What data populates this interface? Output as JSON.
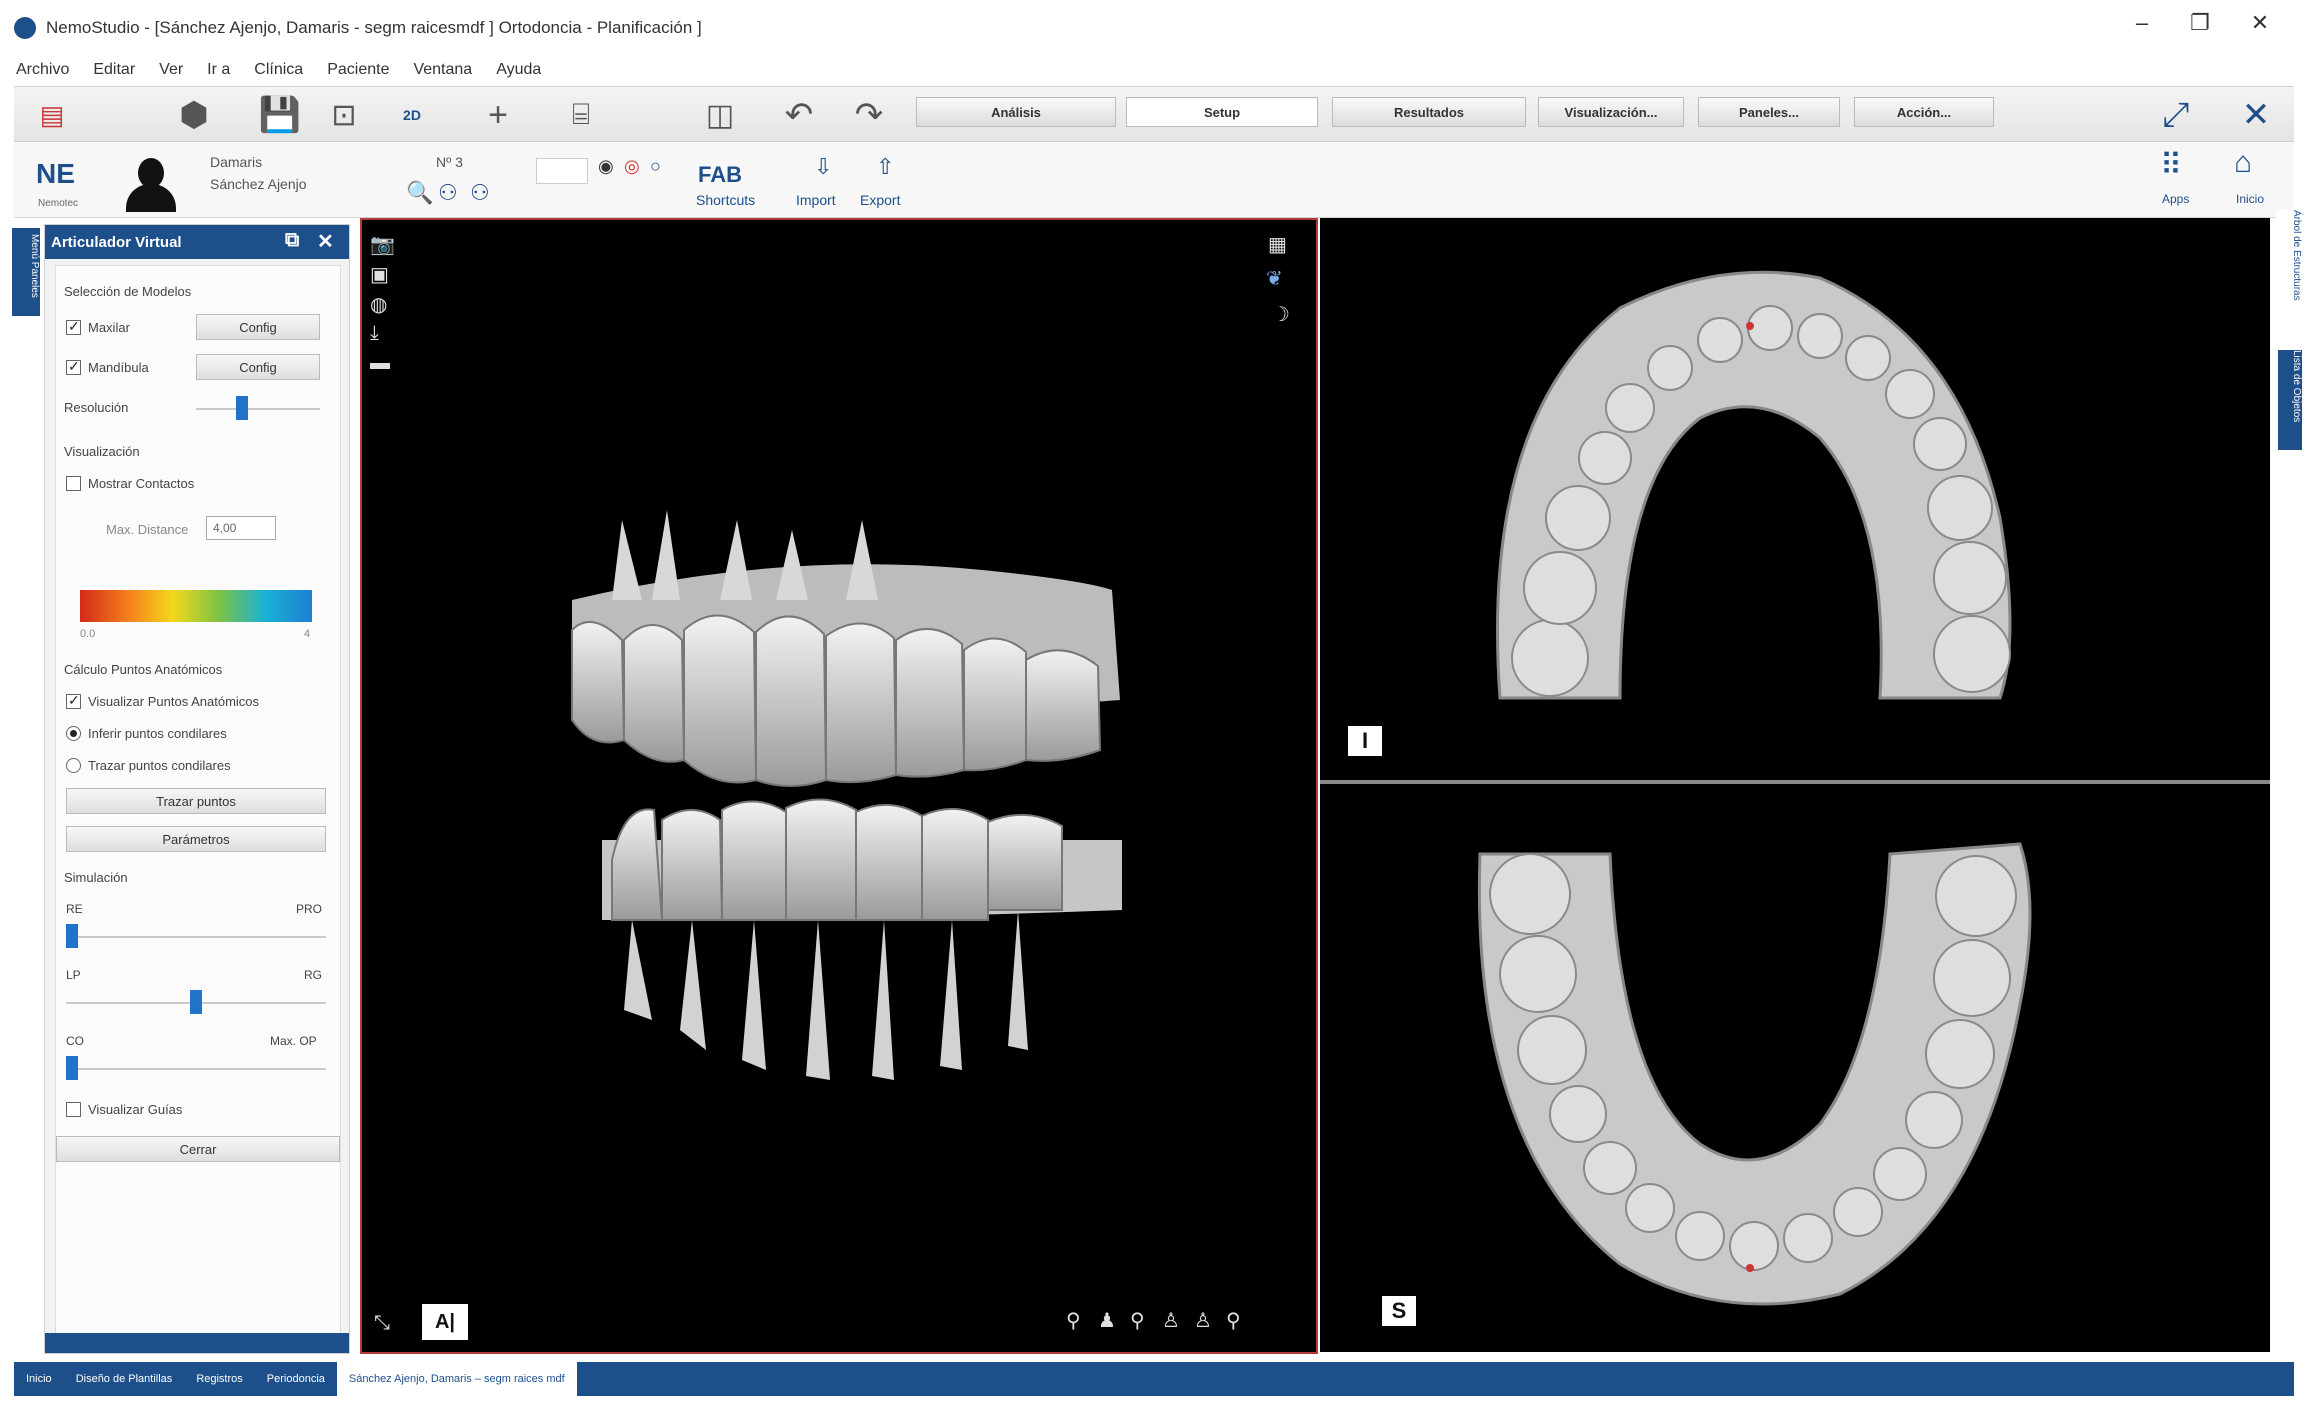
{
  "window": {
    "title": "NemoStudio - [Sánchez Ajenjo, Damaris - segm raicesmdf ] Ortodoncia - Planificación ]",
    "minimize": "–",
    "maximize": "❐",
    "close": "✕"
  },
  "menu": [
    "Archivo",
    "Editar",
    "Ver",
    "Ir a",
    "Clínica",
    "Paciente",
    "Ventana",
    "Ayuda"
  ],
  "toolbar": {
    "tabs": [
      "Análisis",
      "Setup",
      "Resultados",
      "Visualización...",
      "Paneles...",
      "Acción..."
    ],
    "active_tab": "Setup",
    "view_2d_label": "2D"
  },
  "toolbar2": {
    "logo": "NE",
    "logo_sub": "Nemotec",
    "patient_first": "Damaris",
    "patient_last": "Sánchez Ajenjo",
    "patient_number": "Nº 3",
    "fab_label": "FAB",
    "shortcuts_label": "Shortcuts",
    "import_label": "Import",
    "export_label": "Export",
    "apps_label": "Apps",
    "home_label": "Inicio"
  },
  "left_strip_label": "Menú Paneles",
  "panel": {
    "title": "Articulador Virtual",
    "models_section": "Selección de Modelos",
    "maxilar": "Maxilar",
    "mandibula": "Mandíbula",
    "config_label": "Config",
    "resolution_label": "Resolución",
    "visualization_section": "Visualización",
    "show_contacts": "Mostrar Contactos",
    "max_distance_label": "Max. Distance",
    "max_distance_value": "4,00",
    "gradient_min": "0.0",
    "gradient_max": "4",
    "anatomic_section": "Cálculo Puntos Anatómicos",
    "show_anatomic": "Visualizar Puntos Anatómicos",
    "infer_condyle": "Inferir puntos condilares",
    "trace_condyle": "Trazar puntos condilares",
    "trace_points_btn": "Trazar puntos",
    "parameters_btn": "Parámetros",
    "simulation_section": "Simulación",
    "re_label": "RE",
    "pro_label": "PRO",
    "lp_label": "LP",
    "rg_label": "RG",
    "co_label": "CO",
    "max_op_label": "Max. OP",
    "show_guides": "Visualizar Guías",
    "close_btn": "Cerrar"
  },
  "viewports": {
    "top_tag": "I",
    "bottom_tag": "S",
    "ab_label": "A|"
  },
  "right_strip": {
    "tab1": "Árbol de Estructuras",
    "tab2": "Lista de Objetos"
  },
  "statusbar": {
    "tabs": [
      "Inicio",
      "Diseño de Plantillas",
      "Registros",
      "Periodoncia",
      "Sánchez Ajenjo, Damaris – segm raices mdf"
    ],
    "active_index": 4
  }
}
